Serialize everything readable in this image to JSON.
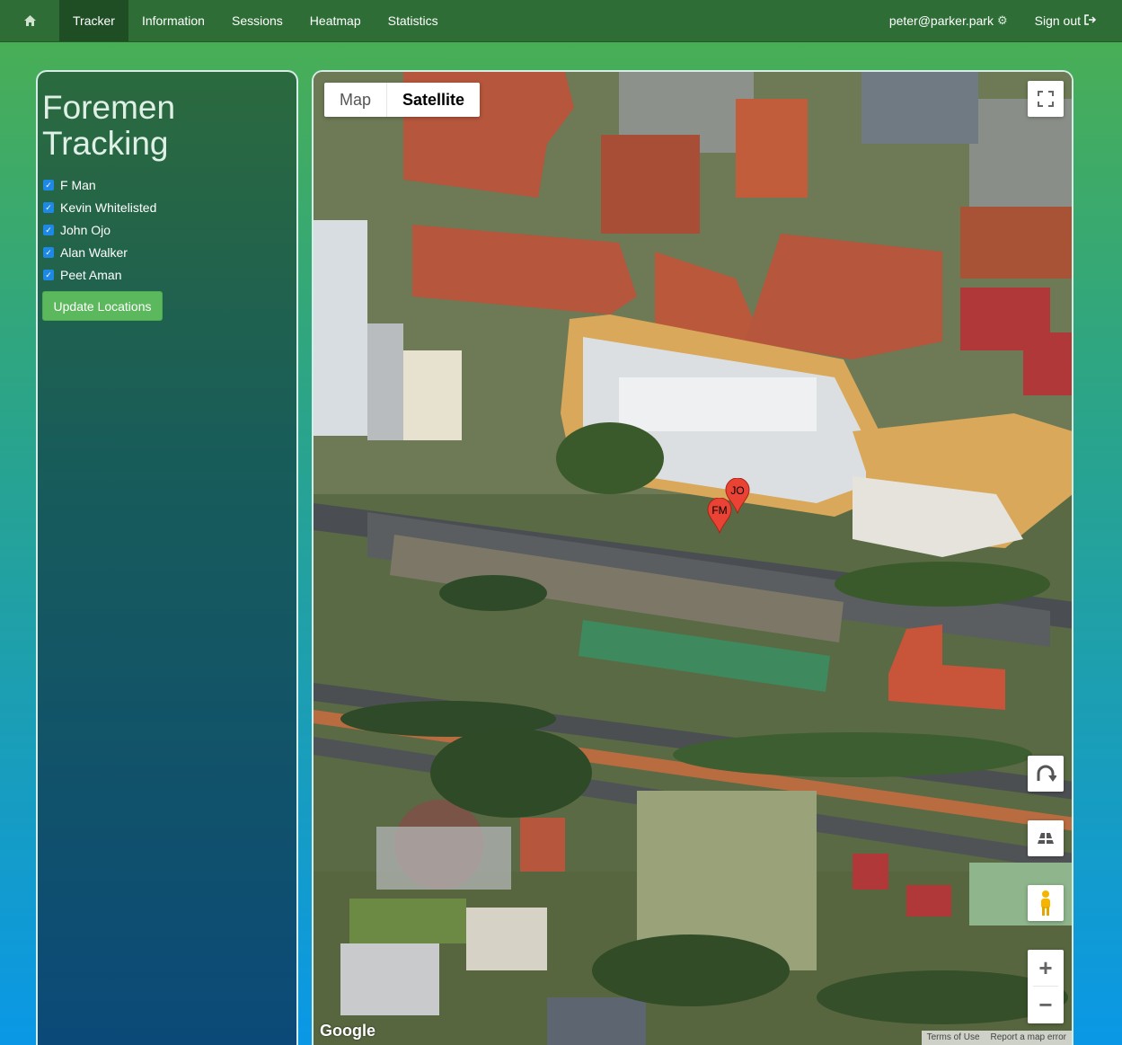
{
  "nav": {
    "links": [
      {
        "label": "Tracker"
      },
      {
        "label": "Information"
      },
      {
        "label": "Sessions"
      },
      {
        "label": "Heatmap"
      },
      {
        "label": "Statistics"
      }
    ],
    "active": "Tracker",
    "user": "peter@parker.park",
    "signout": "Sign out"
  },
  "panel": {
    "title_line1": "Foremen",
    "title_line2": "Tracking",
    "people": [
      {
        "name": "F Man",
        "checked": true
      },
      {
        "name": "Kevin Whitelisted",
        "checked": true
      },
      {
        "name": "John Ojo",
        "checked": true
      },
      {
        "name": "Alan Walker",
        "checked": true
      },
      {
        "name": "Peet Aman",
        "checked": true
      }
    ],
    "update_label": "Update Locations"
  },
  "map": {
    "type_options": [
      "Map",
      "Satellite"
    ],
    "selected_type": "Satellite",
    "markers": [
      {
        "label": "JO"
      },
      {
        "label": "FM"
      }
    ],
    "logo": "Google",
    "terms": "Terms of Use",
    "report": "Report a map error",
    "zoom_in": "+",
    "zoom_out": "−"
  }
}
